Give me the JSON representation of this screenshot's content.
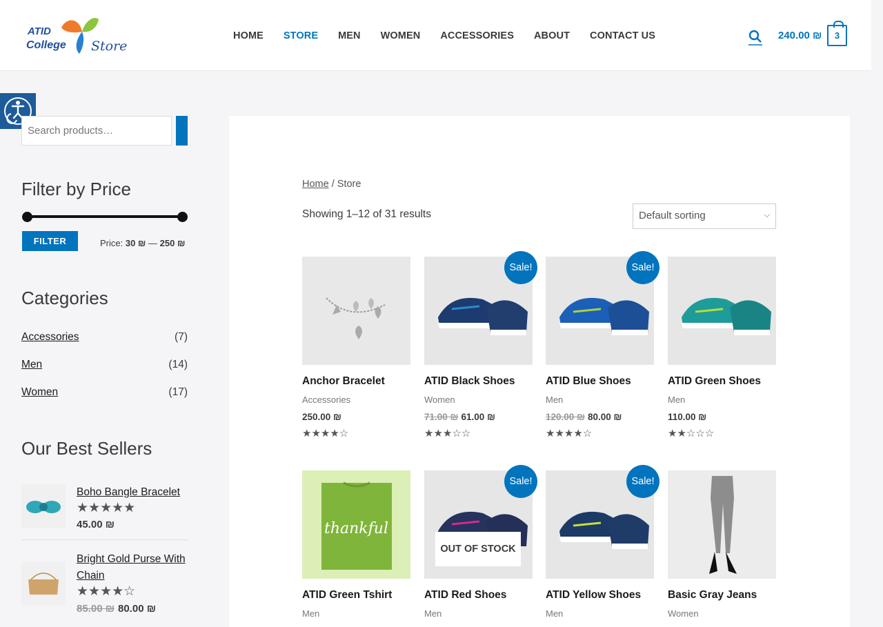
{
  "header": {
    "logo": {
      "line1": "ATID",
      "line2": "College",
      "line3": "Store"
    },
    "nav": [
      "HOME",
      "STORE",
      "MEN",
      "WOMEN",
      "ACCESSORIES",
      "ABOUT",
      "CONTACT US"
    ],
    "active_nav": "STORE",
    "cart_total": "240.00 ₪",
    "cart_count": "3"
  },
  "sidebar": {
    "search_placeholder": "Search products…",
    "filter_title": "Filter by Price",
    "filter_button": "FILTER",
    "price_prefix": "Price:",
    "price_min": "30 ₪",
    "price_sep": "—",
    "price_max": "250 ₪",
    "categories_title": "Categories",
    "categories": [
      {
        "name": "Accessories",
        "count": "(7)"
      },
      {
        "name": "Men",
        "count": "(14)"
      },
      {
        "name": "Women",
        "count": "(17)"
      }
    ],
    "best_sellers_title": "Our Best Sellers",
    "best_sellers": [
      {
        "name": "Boho Bangle Bracelet",
        "rating": "★★★★★",
        "price": "45.00 ₪",
        "old_price": ""
      },
      {
        "name": "Bright Gold Purse With Chain",
        "rating": "★★★★☆",
        "price": "80.00 ₪",
        "old_price": "85.00 ₪"
      }
    ]
  },
  "main": {
    "breadcrumb_home": "Home",
    "breadcrumb_sep": " / ",
    "breadcrumb_current": "Store",
    "result_count": "Showing 1–12 of 31 results",
    "sort_value": "Default sorting",
    "sale_label": "Sale!",
    "out_of_stock": "OUT OF STOCK",
    "products": [
      {
        "title": "Anchor Bracelet",
        "category": "Accessories",
        "price": "250.00 ₪",
        "old_price": "",
        "rating": "★★★★☆",
        "sale": false
      },
      {
        "title": "ATID Black Shoes",
        "category": "Women",
        "price": "61.00 ₪",
        "old_price": "71.00 ₪",
        "rating": "★★★☆☆",
        "sale": true
      },
      {
        "title": "ATID Blue Shoes",
        "category": "Men",
        "price": "80.00 ₪",
        "old_price": "120.00 ₪",
        "rating": "★★★★☆",
        "sale": true
      },
      {
        "title": "ATID Green Shoes",
        "category": "Men",
        "price": "110.00 ₪",
        "old_price": "",
        "rating": "★★☆☆☆",
        "sale": false
      },
      {
        "title": "ATID Green Tshirt",
        "category": "Men",
        "price": "",
        "old_price": "",
        "rating": "",
        "sale": false,
        "shirt_text": "thankful"
      },
      {
        "title": "ATID Red Shoes",
        "category": "Men",
        "price": "",
        "old_price": "",
        "rating": "",
        "sale": true,
        "out_of_stock": true
      },
      {
        "title": "ATID Yellow Shoes",
        "category": "Men",
        "price": "",
        "old_price": "",
        "rating": "",
        "sale": true
      },
      {
        "title": "Basic Gray Jeans",
        "category": "Women",
        "price": "",
        "old_price": "",
        "rating": "",
        "sale": false
      }
    ]
  },
  "colors": {
    "accent": "#0274be",
    "text": "#3a3a3a",
    "background": "#f5f5f7"
  }
}
